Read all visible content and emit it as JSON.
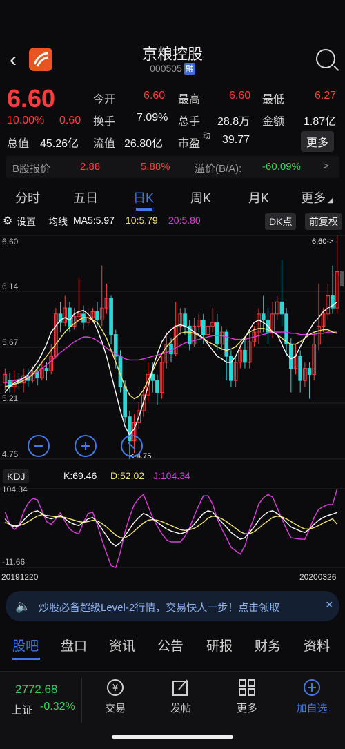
{
  "header": {
    "title": "京粮控股",
    "code": "000505",
    "rong": "融"
  },
  "quote": {
    "price": "6.60",
    "change_pct": "10.00%",
    "change": "0.60",
    "open_label": "今开",
    "open": "6.60",
    "high_label": "最高",
    "high": "6.60",
    "low_label": "最低",
    "low": "6.27",
    "turnover_label": "换手",
    "turnover": "7.09%",
    "vol_label": "总手",
    "vol": "28.8万",
    "amount_label": "金额",
    "amount": "1.87亿",
    "cap_label": "总值",
    "cap": "45.26亿",
    "float_label": "流值",
    "float_cap": "26.80亿",
    "pe_label": "市盈",
    "pe_sup": "动",
    "pe": "39.77",
    "more_btn": "更多"
  },
  "bshare": {
    "label": "B股报价",
    "price": "2.88",
    "pct": "5.88%",
    "premium_label": "溢价(B/A):",
    "premium": "-60.09%",
    "arrow": ">"
  },
  "tabs": [
    "分时",
    "五日",
    "日K",
    "周K",
    "月K",
    "更多"
  ],
  "tabs_active": "日K",
  "toolbar": {
    "settings": "设置",
    "ma_label": "均线",
    "ma5": "MA5:5.97",
    "ma10": "10:5.79",
    "ma20": "20:5.80",
    "dk": "DK点",
    "fq": "前复权"
  },
  "price_axis": [
    "6.60",
    "6.14",
    "5.67",
    "5.21",
    "4.75"
  ],
  "max_label": "6.60->",
  "min_label": "<-4.75",
  "kdj": {
    "label": "KDJ",
    "k": "K:69.46",
    "d": "D:52.02",
    "j": "J:104.34",
    "top": "104.34",
    "bottom": "-11.66"
  },
  "dates": {
    "start": "20191220",
    "end": "20200326"
  },
  "banner": {
    "text": "炒股必备超级Level-2行情，交易快人一步！点击领取"
  },
  "bottom_tabs": [
    "股吧",
    "盘口",
    "资讯",
    "公告",
    "研报",
    "财务",
    "资料"
  ],
  "bottom_nav": {
    "index_value": "2772.68",
    "index_name": "上证",
    "index_pct": "-0.32%",
    "trade": "交易",
    "post": "发帖",
    "more": "更多",
    "add": "加自选"
  },
  "colors": {
    "up": "#ff3b3b",
    "down": "#2fd5d5",
    "accent": "#3f79e6",
    "ma5": "#ffffff",
    "ma10": "#f5e66b",
    "ma20": "#e23be0"
  },
  "chart_data": {
    "type": "candlestick",
    "ylim": [
      4.75,
      6.6
    ],
    "candles": [
      [
        5.38,
        5.45,
        5.32,
        5.5
      ],
      [
        5.4,
        5.35,
        5.3,
        5.46
      ],
      [
        5.35,
        5.4,
        5.3,
        5.48
      ],
      [
        5.4,
        5.38,
        5.33,
        5.46
      ],
      [
        5.38,
        5.44,
        5.3,
        5.5
      ],
      [
        5.44,
        5.4,
        5.35,
        5.5
      ],
      [
        5.4,
        5.47,
        5.38,
        5.52
      ],
      [
        5.47,
        5.42,
        5.36,
        5.52
      ],
      [
        5.42,
        5.5,
        5.4,
        5.56
      ],
      [
        5.5,
        5.48,
        5.4,
        5.55
      ],
      [
        5.48,
        5.6,
        5.45,
        5.7
      ],
      [
        5.6,
        5.95,
        5.58,
        6.0
      ],
      [
        5.95,
        5.88,
        5.8,
        6.05
      ],
      [
        5.88,
        6.0,
        5.85,
        6.1
      ],
      [
        6.0,
        5.85,
        5.8,
        6.05
      ],
      [
        5.85,
        5.93,
        5.82,
        6.0
      ],
      [
        5.93,
        5.95,
        5.88,
        6.25
      ],
      [
        5.95,
        5.88,
        5.82,
        6.02
      ],
      [
        5.88,
        5.92,
        5.85,
        6.0
      ],
      [
        5.92,
        5.97,
        5.88,
        6.0
      ],
      [
        5.97,
        5.9,
        5.85,
        6.05
      ],
      [
        5.9,
        6.0,
        5.85,
        6.35
      ],
      [
        6.0,
        6.08,
        5.95,
        6.2
      ],
      [
        6.08,
        5.78,
        5.7,
        6.1
      ],
      [
        5.78,
        5.6,
        5.5,
        5.82
      ],
      [
        5.6,
        5.35,
        5.3,
        5.65
      ],
      [
        5.35,
        5.1,
        5.05,
        5.4
      ],
      [
        5.1,
        4.9,
        4.75,
        5.15
      ],
      [
        4.9,
        5.05,
        4.8,
        5.12
      ],
      [
        5.05,
        5.15,
        5.0,
        5.22
      ],
      [
        5.15,
        5.28,
        5.1,
        5.35
      ],
      [
        5.28,
        5.45,
        5.22,
        5.55
      ],
      [
        5.45,
        5.4,
        5.3,
        5.55
      ],
      [
        5.4,
        5.3,
        5.2,
        5.45
      ],
      [
        5.3,
        5.55,
        5.25,
        5.6
      ],
      [
        5.55,
        5.7,
        5.5,
        5.8
      ],
      [
        5.7,
        5.62,
        5.55,
        5.75
      ],
      [
        5.62,
        5.85,
        5.6,
        6.05
      ],
      [
        5.85,
        5.95,
        5.78,
        6.0
      ],
      [
        5.95,
        5.85,
        5.78,
        6.0
      ],
      [
        5.85,
        5.7,
        5.65,
        5.9
      ],
      [
        5.7,
        5.85,
        5.68,
        5.92
      ],
      [
        5.85,
        5.9,
        5.8,
        5.95
      ],
      [
        5.9,
        5.78,
        5.7,
        5.95
      ],
      [
        5.78,
        5.85,
        5.72,
        5.9
      ],
      [
        5.85,
        5.88,
        5.8,
        6.0
      ],
      [
        5.88,
        5.7,
        5.65,
        5.95
      ],
      [
        5.7,
        5.8,
        5.65,
        5.85
      ],
      [
        5.8,
        5.6,
        5.4,
        5.82
      ],
      [
        5.6,
        5.4,
        5.35,
        5.65
      ],
      [
        5.4,
        5.55,
        5.35,
        5.6
      ],
      [
        5.55,
        5.65,
        5.5,
        5.7
      ],
      [
        5.65,
        5.55,
        5.5,
        5.75
      ],
      [
        5.55,
        5.72,
        5.5,
        5.8
      ],
      [
        5.72,
        5.8,
        5.68,
        5.85
      ],
      [
        5.8,
        5.95,
        5.7,
        6.0
      ],
      [
        5.95,
        5.9,
        5.8,
        6.1
      ],
      [
        5.9,
        5.8,
        5.7,
        6.0
      ],
      [
        5.8,
        5.95,
        5.75,
        6.05
      ],
      [
        5.95,
        6.05,
        5.9,
        6.1
      ],
      [
        6.05,
        5.95,
        5.85,
        6.4
      ],
      [
        5.95,
        5.7,
        5.6,
        6.0
      ],
      [
        5.7,
        5.5,
        5.3,
        5.75
      ],
      [
        5.5,
        5.6,
        5.45,
        5.7
      ],
      [
        5.6,
        5.4,
        5.3,
        5.65
      ],
      [
        5.4,
        5.5,
        5.35,
        5.55
      ],
      [
        5.5,
        5.45,
        5.25,
        5.55
      ],
      [
        5.45,
        5.7,
        5.4,
        5.8
      ],
      [
        5.7,
        5.85,
        5.65,
        6.2
      ],
      [
        5.85,
        5.95,
        5.8,
        6.0
      ],
      [
        5.95,
        6.1,
        5.9,
        6.2
      ],
      [
        6.1,
        6.0,
        5.95,
        6.35
      ],
      [
        6.0,
        6.3,
        5.95,
        6.6
      ]
    ],
    "ma5": [
      5.3,
      5.35,
      5.38,
      5.4,
      5.42,
      5.45,
      5.5,
      5.55,
      5.62,
      5.7,
      5.8,
      5.85,
      5.9,
      5.92,
      5.9,
      5.95,
      5.97,
      5.98,
      5.95,
      5.9,
      5.82,
      5.72,
      5.6,
      5.45,
      5.3,
      5.15,
      5.02,
      4.95,
      5.0,
      5.1,
      5.22,
      5.35,
      5.5,
      5.62,
      5.72,
      5.78,
      5.82,
      5.85,
      5.86,
      5.85,
      5.83,
      5.8,
      5.78,
      5.75,
      5.7,
      5.65,
      5.6,
      5.58,
      5.55,
      5.55,
      5.6,
      5.68,
      5.75,
      5.82,
      5.88,
      5.9,
      5.88,
      5.85,
      5.8,
      5.78,
      5.7,
      5.62,
      5.58,
      5.6,
      5.68,
      5.75,
      5.82,
      5.88,
      5.92,
      5.97,
      6.0,
      6.02,
      6.05
    ],
    "ma10": [
      5.35,
      5.36,
      5.37,
      5.38,
      5.4,
      5.42,
      5.45,
      5.5,
      5.55,
      5.6,
      5.65,
      5.7,
      5.75,
      5.8,
      5.84,
      5.87,
      5.9,
      5.92,
      5.92,
      5.9,
      5.88,
      5.82,
      5.75,
      5.65,
      5.55,
      5.45,
      5.35,
      5.28,
      5.25,
      5.27,
      5.32,
      5.4,
      5.48,
      5.56,
      5.62,
      5.68,
      5.72,
      5.76,
      5.79,
      5.8,
      5.8,
      5.79,
      5.77,
      5.75,
      5.72,
      5.7,
      5.68,
      5.66,
      5.65,
      5.66,
      5.68,
      5.72,
      5.76,
      5.8,
      5.82,
      5.83,
      5.83,
      5.82,
      5.8,
      5.78,
      5.75,
      5.72,
      5.7,
      5.7,
      5.72,
      5.75,
      5.78,
      5.8,
      5.81,
      5.82,
      5.82,
      5.8,
      5.79
    ],
    "ma20": [
      5.38,
      5.39,
      5.4,
      5.41,
      5.42,
      5.43,
      5.45,
      5.47,
      5.5,
      5.53,
      5.56,
      5.6,
      5.63,
      5.66,
      5.69,
      5.72,
      5.74,
      5.76,
      5.76,
      5.75,
      5.73,
      5.7,
      5.67,
      5.64,
      5.62,
      5.6,
      5.58,
      5.57,
      5.57,
      5.57,
      5.58,
      5.59,
      5.6,
      5.61,
      5.62,
      5.63,
      5.65,
      5.67,
      5.69,
      5.71,
      5.72,
      5.73,
      5.74,
      5.75,
      5.76,
      5.77,
      5.77,
      5.77,
      5.76,
      5.75,
      5.74,
      5.74,
      5.74,
      5.75,
      5.76,
      5.77,
      5.78,
      5.79,
      5.8,
      5.8,
      5.8,
      5.8,
      5.79,
      5.79,
      5.78,
      5.78,
      5.78,
      5.78,
      5.79,
      5.79,
      5.8,
      5.8,
      5.8
    ],
    "kdj_ylim": [
      -11.66,
      104.34
    ],
    "k": [
      60,
      52,
      48,
      50,
      58,
      65,
      70,
      72,
      68,
      62,
      60,
      62,
      65,
      60,
      55,
      52,
      50,
      55,
      60,
      62,
      55,
      45,
      35,
      25,
      20,
      25,
      35,
      45,
      55,
      62,
      68,
      65,
      60,
      55,
      50,
      45,
      42,
      40,
      38,
      40,
      45,
      52,
      60,
      68,
      72,
      70,
      62,
      55,
      48,
      40,
      35,
      30,
      32,
      40,
      48,
      58,
      65,
      70,
      72,
      68,
      62,
      55,
      48,
      45,
      42,
      40,
      45,
      52,
      58,
      62,
      65,
      67,
      69.46
    ],
    "d": [
      55,
      52,
      50,
      50,
      52,
      56,
      60,
      64,
      66,
      65,
      64,
      63,
      63,
      62,
      60,
      58,
      56,
      55,
      56,
      58,
      57,
      53,
      48,
      42,
      36,
      32,
      32,
      36,
      42,
      48,
      54,
      58,
      59,
      58,
      56,
      53,
      50,
      47,
      44,
      43,
      44,
      46,
      50,
      55,
      61,
      64,
      63,
      60,
      56,
      51,
      46,
      41,
      38,
      38,
      41,
      46,
      52,
      57,
      62,
      64,
      63,
      60,
      56,
      52,
      48,
      45,
      45,
      47,
      50,
      54,
      57,
      60,
      52.02
    ],
    "j": [
      70,
      52,
      44,
      50,
      70,
      83,
      90,
      88,
      72,
      56,
      52,
      60,
      69,
      56,
      45,
      40,
      38,
      55,
      68,
      70,
      51,
      29,
      9,
      -9,
      -12,
      11,
      41,
      63,
      81,
      90,
      96,
      79,
      62,
      49,
      38,
      29,
      26,
      26,
      26,
      34,
      47,
      64,
      80,
      94,
      94,
      82,
      60,
      45,
      32,
      18,
      13,
      8,
      20,
      44,
      62,
      82,
      91,
      96,
      92,
      76,
      60,
      45,
      32,
      31,
      30,
      30,
      45,
      62,
      74,
      78,
      81,
      81,
      104.34
    ]
  }
}
